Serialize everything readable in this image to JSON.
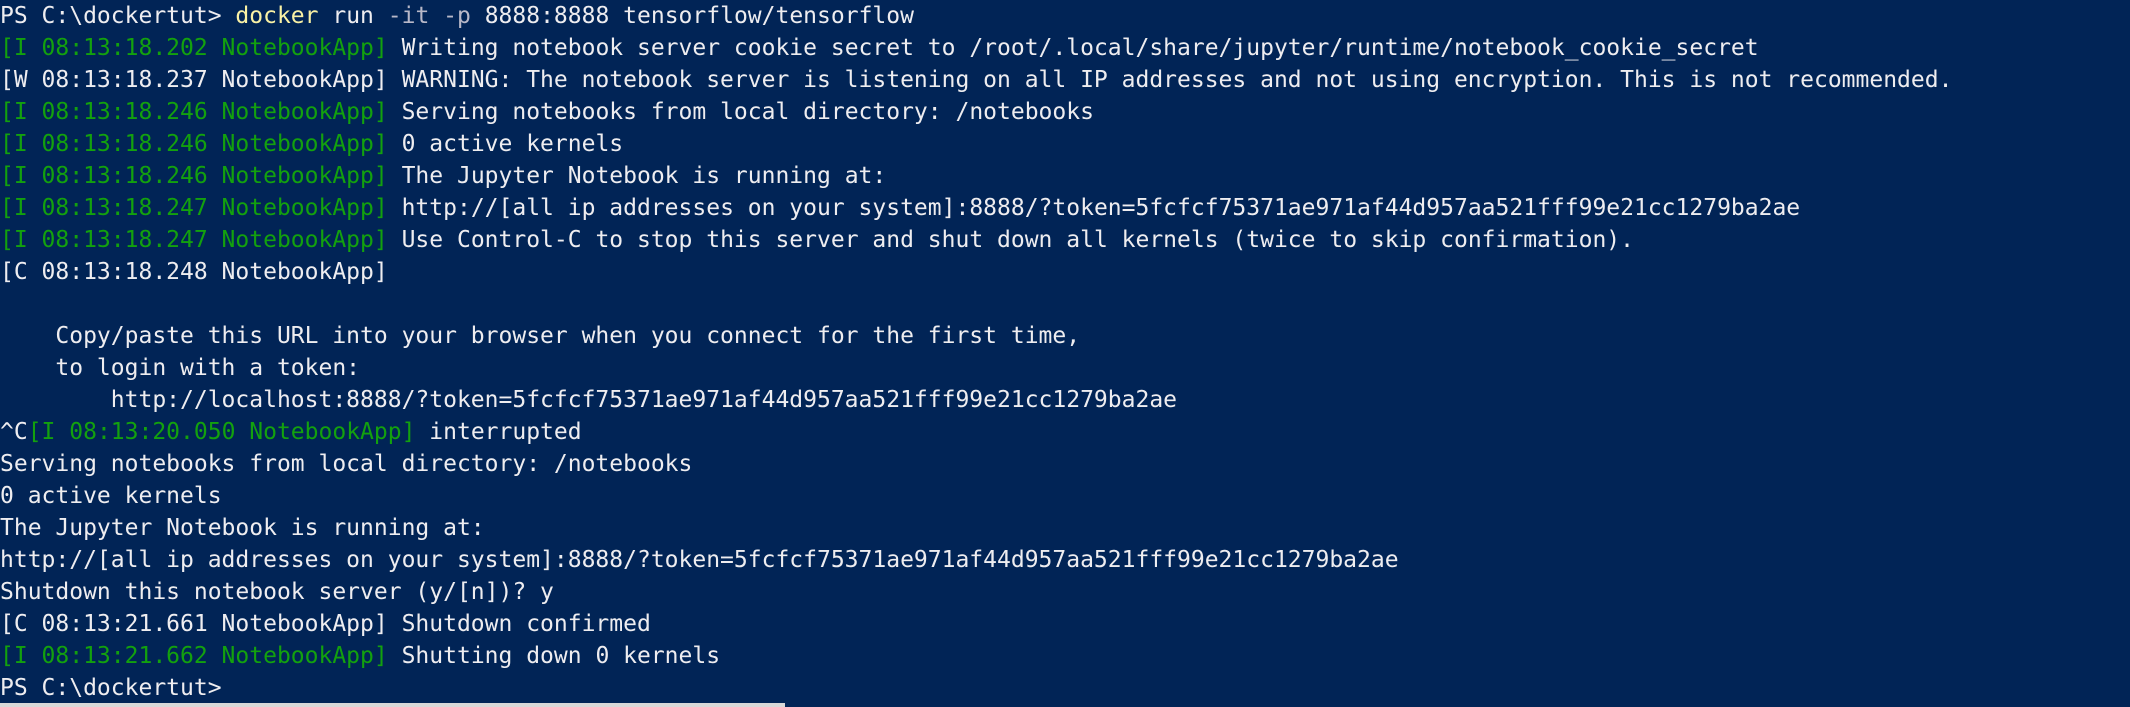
{
  "colors": {
    "background": "#012456",
    "default": "#eeedf0",
    "yellow": "#f9f1a5",
    "gray": "#b8b8c8",
    "green": "#13a10e"
  },
  "terminal": {
    "lines": [
      [
        {
          "t": "PS C:\\dockertut> ",
          "c": "default"
        },
        {
          "t": "docker",
          "c": "yellow"
        },
        {
          "t": " run ",
          "c": "default"
        },
        {
          "t": "-it -p",
          "c": "gray"
        },
        {
          "t": " 8888:8888 tensorflow/tensorflow",
          "c": "default"
        }
      ],
      [
        {
          "t": "[I 08:13:18.202 NotebookApp]",
          "c": "green"
        },
        {
          "t": " Writing notebook server cookie secret to /root/.local/share/jupyter/runtime/notebook_cookie_secret",
          "c": "default"
        }
      ],
      [
        {
          "t": "[W 08:13:18.237 NotebookApp] WARNING: The notebook server is listening on all IP addresses and not using encryption. This is not recommended.",
          "c": "default"
        }
      ],
      [
        {
          "t": "[I 08:13:18.246 NotebookApp]",
          "c": "green"
        },
        {
          "t": " Serving notebooks from local directory: /notebooks",
          "c": "default"
        }
      ],
      [
        {
          "t": "[I 08:13:18.246 NotebookApp]",
          "c": "green"
        },
        {
          "t": " 0 active kernels",
          "c": "default"
        }
      ],
      [
        {
          "t": "[I 08:13:18.246 NotebookApp]",
          "c": "green"
        },
        {
          "t": " The Jupyter Notebook is running at:",
          "c": "default"
        }
      ],
      [
        {
          "t": "[I 08:13:18.247 NotebookApp]",
          "c": "green"
        },
        {
          "t": " http://[all ip addresses on your system]:8888/?token=5fcfcf75371ae971af44d957aa521fff99e21cc1279ba2ae",
          "c": "default"
        }
      ],
      [
        {
          "t": "[I 08:13:18.247 NotebookApp]",
          "c": "green"
        },
        {
          "t": " Use Control-C to stop this server and shut down all kernels (twice to skip confirmation).",
          "c": "default"
        }
      ],
      [
        {
          "t": "[C 08:13:18.248 NotebookApp]",
          "c": "default"
        }
      ],
      [
        {
          "t": "",
          "c": "default"
        }
      ],
      [
        {
          "t": "    Copy/paste this URL into your browser when you connect for the first time,",
          "c": "default"
        }
      ],
      [
        {
          "t": "    to login with a token:",
          "c": "default"
        }
      ],
      [
        {
          "t": "        http://localhost:8888/?token=5fcfcf75371ae971af44d957aa521fff99e21cc1279ba2ae",
          "c": "default"
        }
      ],
      [
        {
          "t": "^C",
          "c": "default"
        },
        {
          "t": "[I 08:13:20.050 NotebookApp]",
          "c": "green"
        },
        {
          "t": " interrupted",
          "c": "default"
        }
      ],
      [
        {
          "t": "Serving notebooks from local directory: /notebooks",
          "c": "default"
        }
      ],
      [
        {
          "t": "0 active kernels",
          "c": "default"
        }
      ],
      [
        {
          "t": "The Jupyter Notebook is running at:",
          "c": "default"
        }
      ],
      [
        {
          "t": "http://[all ip addresses on your system]:8888/?token=5fcfcf75371ae971af44d957aa521fff99e21cc1279ba2ae",
          "c": "default"
        }
      ],
      [
        {
          "t": "Shutdown this notebook server (y/[n])? y",
          "c": "default"
        }
      ],
      [
        {
          "t": "[C 08:13:21.661 NotebookApp] Shutdown confirmed",
          "c": "default"
        }
      ],
      [
        {
          "t": "[I 08:13:21.662 NotebookApp]",
          "c": "green"
        },
        {
          "t": " Shutting down 0 kernels",
          "c": "default"
        }
      ],
      [
        {
          "t": "PS C:\\dockertut>",
          "c": "default"
        }
      ]
    ]
  }
}
